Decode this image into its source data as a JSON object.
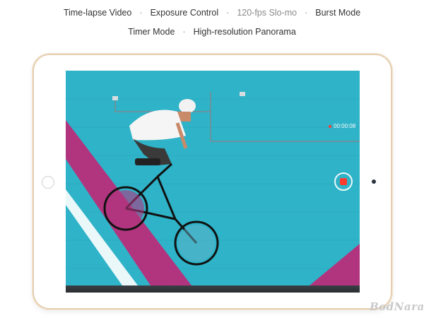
{
  "features": {
    "row1": [
      {
        "label": "Time-lapse Video",
        "dim": false
      },
      {
        "label": "Exposure Control",
        "dim": false
      },
      {
        "label": "120-fps Slo-mo",
        "dim": true
      },
      {
        "label": "Burst Mode",
        "dim": false
      }
    ],
    "row2": [
      {
        "label": "Timer Mode",
        "dim": false
      },
      {
        "label": "High-resolution Panorama",
        "dim": false
      }
    ],
    "separator": "·"
  },
  "camera_ui": {
    "timer": "00:00:08",
    "record_button_icon": "record-stop-icon"
  },
  "device": {
    "frame_color": "#e6cfb0",
    "home_button_icon": "home-button",
    "camera_icon": "front-camera"
  },
  "watermark": "BodNara",
  "colors": {
    "wall": "#2fb3c8",
    "stripe_magenta": "#b1357e",
    "record_red": "#ff3b30"
  }
}
